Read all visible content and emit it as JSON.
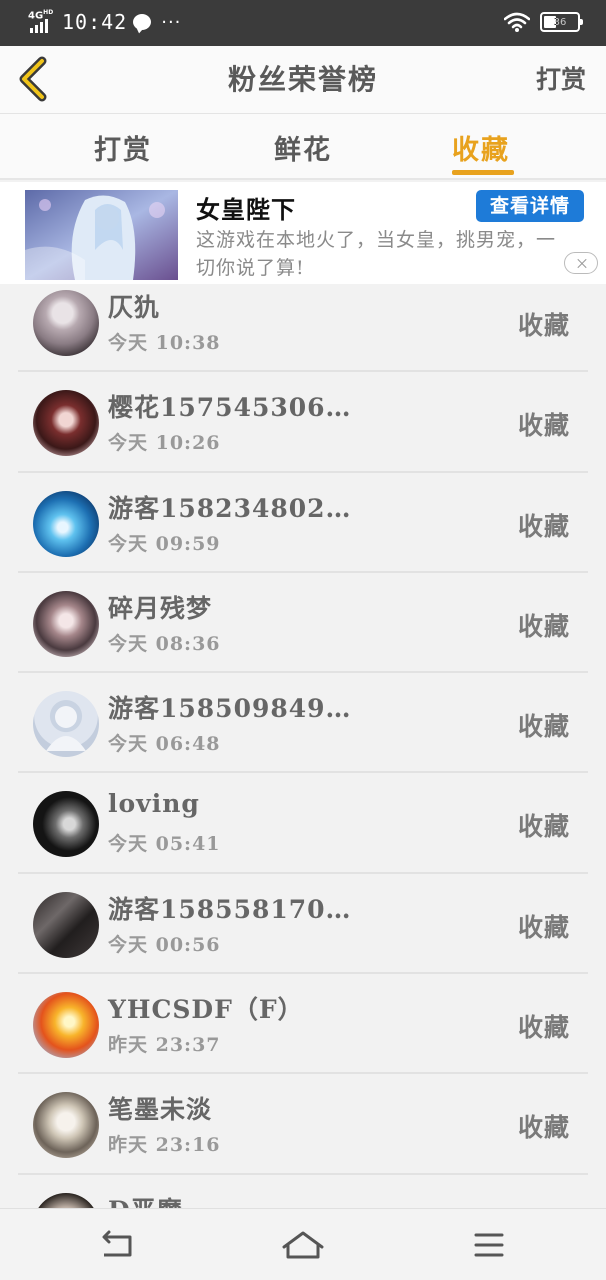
{
  "status_bar": {
    "network": "4G",
    "network_suffix": "HD",
    "time": "10:42",
    "more_indicator": "···",
    "battery": "36",
    "icons": [
      "signal-icon",
      "chat-bubble-icon",
      "wifi-icon",
      "battery-icon"
    ]
  },
  "header": {
    "title": "粉丝荣誉榜",
    "action": "打赏",
    "back_icon": "chevron-left-icon"
  },
  "tabs": [
    {
      "label": "打赏",
      "active": false
    },
    {
      "label": "鲜花",
      "active": false
    },
    {
      "label": "收藏",
      "active": true
    }
  ],
  "ad": {
    "title": "女皇陛下",
    "cta": "查看详情",
    "description": "这游戏在本地火了，当女皇，挑男宠，一切你说了算!"
  },
  "list": [
    {
      "name": "仄犰",
      "time": "今天 10:38",
      "action": "收藏"
    },
    {
      "name": "樱花157545306…",
      "time": "今天 10:26",
      "action": "收藏"
    },
    {
      "name": "游客158234802…",
      "time": "今天 09:59",
      "action": "收藏"
    },
    {
      "name": "碎月残梦",
      "time": "今天 08:36",
      "action": "收藏"
    },
    {
      "name": "游客158509849…",
      "time": "今天 06:48",
      "action": "收藏"
    },
    {
      "name": "loving",
      "time": "今天 05:41",
      "action": "收藏"
    },
    {
      "name": "游客158558170…",
      "time": "今天 00:56",
      "action": "收藏"
    },
    {
      "name": "YHCSDF（F）",
      "time": "昨天 23:37",
      "action": "收藏"
    },
    {
      "name": "笔墨未淡",
      "time": "昨天 23:16",
      "action": "收藏"
    },
    {
      "name": "D恶魔",
      "time": "",
      "action": ""
    }
  ],
  "nav": {
    "icons": [
      "back-arrow-icon",
      "home-icon",
      "menu-icon"
    ]
  },
  "colors": {
    "accent": "#e8a21e",
    "cta_blue": "#1e7bd8",
    "status_bar": "#3b3b3b"
  }
}
